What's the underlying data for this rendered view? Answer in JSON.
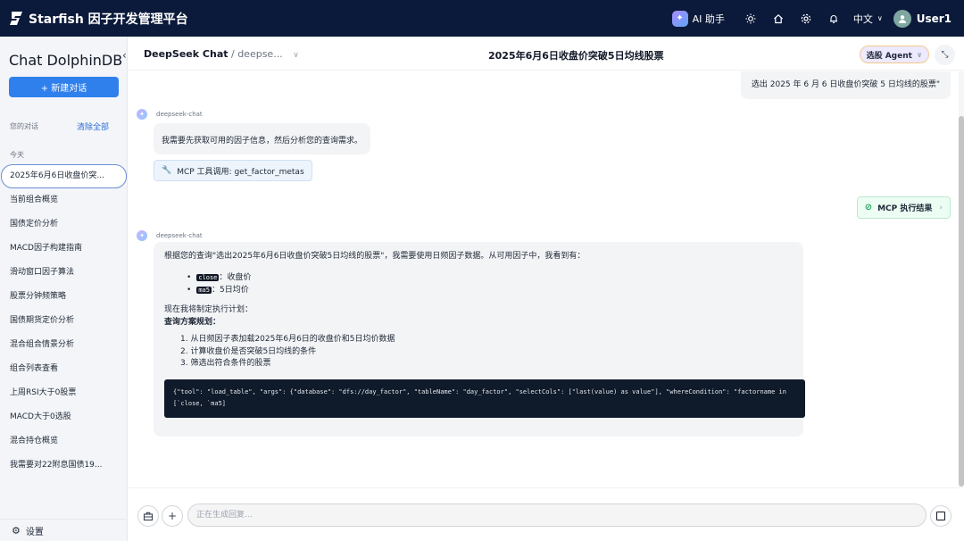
{
  "app": {
    "brand": "Starfish 因子开发管理平台",
    "ai_label": "AI 助手",
    "lang": "中文",
    "user": "User1"
  },
  "sidebar": {
    "title": "Chat DolphinDB",
    "new_chat": "+ 新建对话",
    "section_label": "您的对话",
    "clear_all": "清除全部",
    "today_label": "今天",
    "items": [
      {
        "label": "2025年6月6日收盘价突..."
      },
      {
        "label": "当前组合概览"
      },
      {
        "label": "国债定价分析"
      },
      {
        "label": "MACD因子构建指南"
      },
      {
        "label": "滑动窗口因子算法"
      },
      {
        "label": "股票分钟频策略"
      },
      {
        "label": "国债期货定价分析"
      },
      {
        "label": "混合组合情景分析"
      },
      {
        "label": "组合列表查看"
      },
      {
        "label": "上周RSI大于0股票"
      },
      {
        "label": "MACD大于0选股"
      },
      {
        "label": "混合持仓概览"
      },
      {
        "label": "我需要对22附息国债19..."
      }
    ],
    "settings": "设置"
  },
  "header": {
    "model": "DeepSeek Chat",
    "model_sub": "/ deepse...",
    "title": "2025年6月6日收盘价突破5日均线股票",
    "agent_button": "选股 Agent"
  },
  "messages": {
    "user_query": "选出 2025 年 6 月 6 日收盘价突破 5 日均线的股票\"",
    "bot_name": "deepseek-chat",
    "bot_msg_1": "我需要先获取可用的因子信息，然后分析您的查询需求。",
    "mcp_call": "MCP 工具调用: get_factor_metas",
    "mcp_result": "MCP 执行结果",
    "bot_name_2": "deepseek-chat",
    "resp_intro": "根据您的查询\"选出2025年6月6日收盘价突破5日均线的股票\"，我需要使用日频因子数据。从可用因子中，我看到有：",
    "factors": [
      {
        "code": "close",
        "desc": "：收盘价"
      },
      {
        "code": "ma5",
        "desc": "：5日均价"
      }
    ],
    "plan_intro": "现在我将制定执行计划：",
    "plan_title": "查询方案规划：",
    "plan_steps": [
      "1. 从日频因子表加载2025年6月6日的收盘价和5日均价数据",
      "2. 计算收盘价是否突破5日均线的条件",
      "3. 筛选出符合条件的股票"
    ],
    "code": "{\"tool\": \"load_table\", \"args\": {\"database\": \"dfs://day_factor\", \"tableName\": \"day_factor\", \"selectCols\": [\"last(value) as value\"], \"whereCondition\": \"factorname in [`close, `ma5]"
  },
  "input": {
    "placeholder": "正在生成回复..."
  },
  "colors": {
    "topbar": "#0b1a3a",
    "accent": "#2f80ed",
    "code_bg": "#0f1a2a"
  }
}
